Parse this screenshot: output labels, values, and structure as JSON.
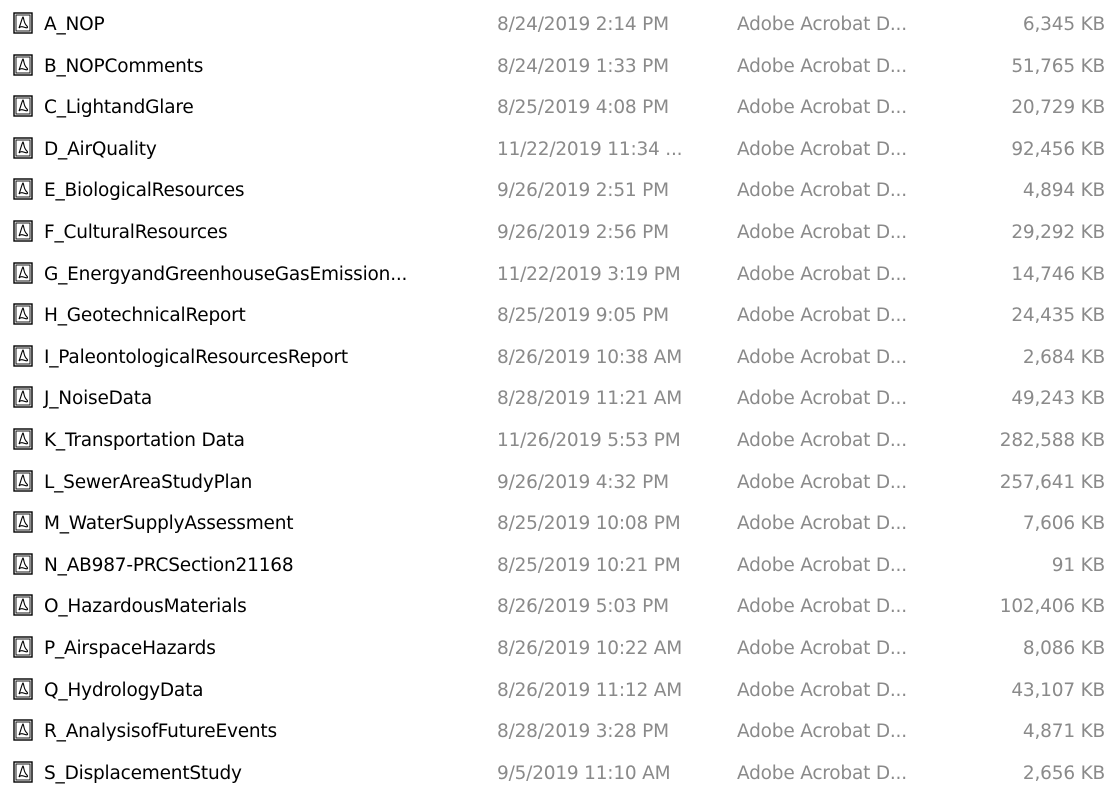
{
  "file_icon": "pdf-document-icon",
  "colors": {
    "name_text": "#000000",
    "meta_text": "#8a8a8a",
    "background": "#ffffff"
  },
  "files": [
    {
      "name": "A_NOP",
      "date": "8/24/2019 2:14 PM",
      "type": "Adobe Acrobat D...",
      "size": "6,345 KB"
    },
    {
      "name": "B_NOPComments",
      "date": "8/24/2019 1:33 PM",
      "type": "Adobe Acrobat D...",
      "size": "51,765 KB"
    },
    {
      "name": "C_LightandGlare",
      "date": "8/25/2019 4:08 PM",
      "type": "Adobe Acrobat D...",
      "size": "20,729 KB"
    },
    {
      "name": "D_AirQuality",
      "date": "11/22/2019 11:34 ...",
      "type": "Adobe Acrobat D...",
      "size": "92,456 KB"
    },
    {
      "name": "E_BiologicalResources",
      "date": "9/26/2019 2:51 PM",
      "type": "Adobe Acrobat D...",
      "size": "4,894 KB"
    },
    {
      "name": "F_CulturalResources",
      "date": "9/26/2019 2:56 PM",
      "type": "Adobe Acrobat D...",
      "size": "29,292 KB"
    },
    {
      "name": "G_EnergyandGreenhouseGasEmission...",
      "date": "11/22/2019 3:19 PM",
      "type": "Adobe Acrobat D...",
      "size": "14,746 KB"
    },
    {
      "name": "H_GeotechnicalReport",
      "date": "8/25/2019 9:05 PM",
      "type": "Adobe Acrobat D...",
      "size": "24,435 KB"
    },
    {
      "name": "I_PaleontologicalResourcesReport",
      "date": "8/26/2019 10:38 AM",
      "type": "Adobe Acrobat D...",
      "size": "2,684 KB"
    },
    {
      "name": "J_NoiseData",
      "date": "8/28/2019 11:21 AM",
      "type": "Adobe Acrobat D...",
      "size": "49,243 KB"
    },
    {
      "name": "K_Transportation Data",
      "date": "11/26/2019 5:53 PM",
      "type": "Adobe Acrobat D...",
      "size": "282,588 KB"
    },
    {
      "name": "L_SewerAreaStudyPlan",
      "date": "9/26/2019 4:32 PM",
      "type": "Adobe Acrobat D...",
      "size": "257,641 KB"
    },
    {
      "name": "M_WaterSupplyAssessment",
      "date": "8/25/2019 10:08 PM",
      "type": "Adobe Acrobat D...",
      "size": "7,606 KB"
    },
    {
      "name": "N_AB987-PRCSection21168",
      "date": "8/25/2019 10:21 PM",
      "type": "Adobe Acrobat D...",
      "size": "91 KB"
    },
    {
      "name": "O_HazardousMaterials",
      "date": "8/26/2019 5:03 PM",
      "type": "Adobe Acrobat D...",
      "size": "102,406 KB"
    },
    {
      "name": "P_AirspaceHazards",
      "date": "8/26/2019 10:22 AM",
      "type": "Adobe Acrobat D...",
      "size": "8,086 KB"
    },
    {
      "name": "Q_HydrologyData",
      "date": "8/26/2019 11:12 AM",
      "type": "Adobe Acrobat D...",
      "size": "43,107 KB"
    },
    {
      "name": "R_AnalysisofFutureEvents",
      "date": "8/28/2019 3:28 PM",
      "type": "Adobe Acrobat D...",
      "size": "4,871 KB"
    },
    {
      "name": "S_DisplacementStudy",
      "date": "9/5/2019 11:10 AM",
      "type": "Adobe Acrobat D...",
      "size": "2,656 KB"
    }
  ]
}
